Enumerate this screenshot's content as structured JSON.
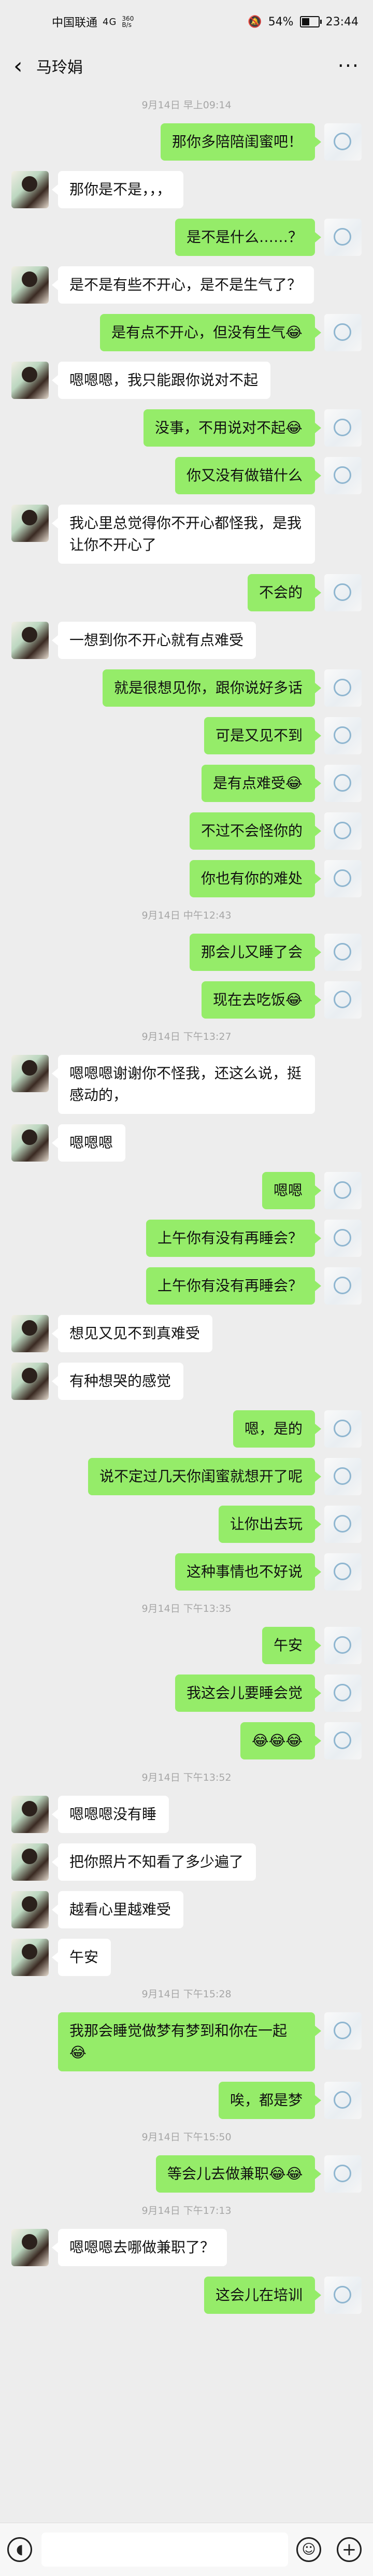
{
  "status": {
    "carrier": "中国联通",
    "signal": "4G",
    "net_speed": [
      "360",
      "B/s"
    ],
    "battery": "54%",
    "battery_level": 0.54,
    "time": "23:44"
  },
  "header": {
    "title": "马玲娟",
    "back_icon": "back-chevron-icon",
    "more_icon": "more-dots-icon"
  },
  "messages": [
    {
      "type": "time",
      "text": "9月14日 早上09:14"
    },
    {
      "type": "msg",
      "from": "self",
      "text": "那你多陪陪闺蜜吧！"
    },
    {
      "type": "msg",
      "from": "other",
      "text": "那你是不是，，，"
    },
    {
      "type": "msg",
      "from": "self",
      "text": "是不是什么……？"
    },
    {
      "type": "msg",
      "from": "other",
      "text": "是不是有些不开心，是不是生气了？"
    },
    {
      "type": "msg",
      "from": "self",
      "text": "是有点不开心，但没有生气😂"
    },
    {
      "type": "msg",
      "from": "other",
      "text": "嗯嗯嗯，我只能跟你说对不起"
    },
    {
      "type": "msg",
      "from": "self",
      "text": "没事，不用说对不起😂"
    },
    {
      "type": "msg",
      "from": "self",
      "text": "你又没有做错什么"
    },
    {
      "type": "msg",
      "from": "other",
      "text": "我心里总觉得你不开心都怪我，是我让你不开心了"
    },
    {
      "type": "msg",
      "from": "self",
      "text": "不会的"
    },
    {
      "type": "msg",
      "from": "other",
      "text": "一想到你不开心就有点难受"
    },
    {
      "type": "msg",
      "from": "self",
      "text": "就是很想见你，跟你说好多话"
    },
    {
      "type": "msg",
      "from": "self",
      "text": "可是又见不到"
    },
    {
      "type": "msg",
      "from": "self",
      "text": "是有点难受😂"
    },
    {
      "type": "msg",
      "from": "self",
      "text": "不过不会怪你的"
    },
    {
      "type": "msg",
      "from": "self",
      "text": "你也有你的难处"
    },
    {
      "type": "time",
      "text": "9月14日 中午12:43"
    },
    {
      "type": "msg",
      "from": "self",
      "text": "那会儿又睡了会"
    },
    {
      "type": "msg",
      "from": "self",
      "text": "现在去吃饭😂"
    },
    {
      "type": "time",
      "text": "9月14日 下午13:27"
    },
    {
      "type": "msg",
      "from": "other",
      "text": "嗯嗯嗯谢谢你不怪我，还这么说，挺感动的，"
    },
    {
      "type": "msg",
      "from": "other",
      "text": "嗯嗯嗯"
    },
    {
      "type": "msg",
      "from": "self",
      "text": "嗯嗯"
    },
    {
      "type": "msg",
      "from": "self",
      "text": "上午你有没有再睡会？"
    },
    {
      "type": "msg",
      "from": "self",
      "text": "上午你有没有再睡会？"
    },
    {
      "type": "msg",
      "from": "other",
      "text": "想见又见不到真难受"
    },
    {
      "type": "msg",
      "from": "other",
      "text": "有种想哭的感觉"
    },
    {
      "type": "msg",
      "from": "self",
      "text": "嗯，是的"
    },
    {
      "type": "msg",
      "from": "self",
      "text": "说不定过几天你闺蜜就想开了呢"
    },
    {
      "type": "msg",
      "from": "self",
      "text": "让你出去玩"
    },
    {
      "type": "msg",
      "from": "self",
      "text": "这种事情也不好说"
    },
    {
      "type": "time",
      "text": "9月14日 下午13:35"
    },
    {
      "type": "msg",
      "from": "self",
      "text": "午安"
    },
    {
      "type": "msg",
      "from": "self",
      "text": "我这会儿要睡会觉"
    },
    {
      "type": "msg",
      "from": "self",
      "text": "😂😂😂"
    },
    {
      "type": "time",
      "text": "9月14日 下午13:52"
    },
    {
      "type": "msg",
      "from": "other",
      "text": "嗯嗯嗯没有睡"
    },
    {
      "type": "msg",
      "from": "other",
      "text": "把你照片不知看了多少遍了"
    },
    {
      "type": "msg",
      "from": "other",
      "text": "越看心里越难受"
    },
    {
      "type": "msg",
      "from": "other",
      "text": "午安"
    },
    {
      "type": "time",
      "text": "9月14日 下午15:28"
    },
    {
      "type": "msg",
      "from": "self",
      "text": "我那会睡觉做梦有梦到和你在一起😂"
    },
    {
      "type": "msg",
      "from": "self",
      "text": "唉，都是梦"
    },
    {
      "type": "time",
      "text": "9月14日 下午15:50"
    },
    {
      "type": "msg",
      "from": "self",
      "text": "等会儿去做兼职😂😂"
    },
    {
      "type": "time",
      "text": "9月14日 下午17:13"
    },
    {
      "type": "msg",
      "from": "other",
      "text": "嗯嗯嗯去哪做兼职了？"
    },
    {
      "type": "msg",
      "from": "self",
      "text": "这会儿在培训"
    }
  ],
  "inputbar": {
    "voice_icon": "voice-icon",
    "emoji_icon": "emoji-icon",
    "plus_icon": "plus-icon"
  }
}
